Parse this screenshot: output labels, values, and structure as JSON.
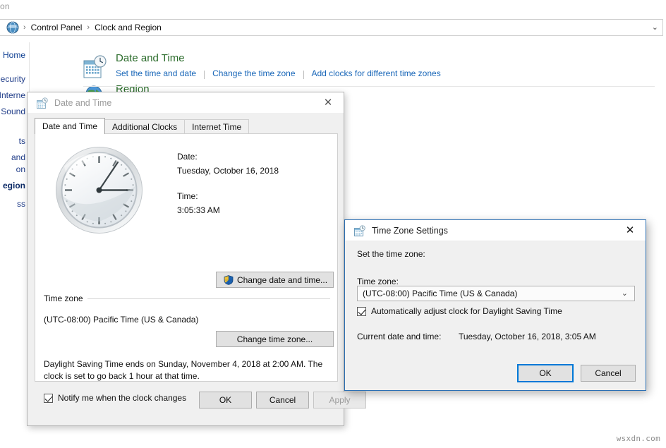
{
  "control_panel": {
    "partial_window_title": "on",
    "address": {
      "icon": "control-panel-globe-icon",
      "crumb_separator": "›",
      "crumbs": [
        "Control Panel",
        "Clock and Region"
      ],
      "dropdown_arrow": "⌄"
    },
    "nav_items": [
      {
        "label": "l Home",
        "bold": false
      },
      {
        "label": "ecurity",
        "bold": false
      },
      {
        "label": "Interne",
        "bold": false
      },
      {
        "label": "d Sound",
        "bold": false
      },
      {
        "label": "ts",
        "bold": false
      },
      {
        "label": "and",
        "bold": false
      },
      {
        "label": "on",
        "bold": false
      },
      {
        "label": "egion",
        "bold": true
      },
      {
        "label": "ss",
        "bold": false
      }
    ],
    "categories": [
      {
        "icon": "date-and-time-icon",
        "title": "Date and Time",
        "links": [
          "Set the time and date",
          "Change the time zone",
          "Add clocks for different time zones"
        ]
      },
      {
        "icon": "region-globe-icon",
        "title": "Region",
        "links": []
      }
    ]
  },
  "date_time_dialog": {
    "icon": "date-and-time-icon",
    "title": "Date and Time",
    "close_label": "✕",
    "tabs": [
      {
        "label": "Date and Time",
        "selected": true
      },
      {
        "label": "Additional Clocks",
        "selected": false
      },
      {
        "label": "Internet Time",
        "selected": false
      }
    ],
    "clock": {
      "name": "analog-clock",
      "hour": 3,
      "minute": 5,
      "second": 33
    },
    "date_label": "Date:",
    "date_value": "Tuesday, October 16, 2018",
    "time_label": "Time:",
    "time_value": "3:05:33 AM",
    "change_date_time_button": "Change date and time...",
    "timezone_group_label": "Time zone",
    "timezone_value": "(UTC-08:00) Pacific Time (US & Canada)",
    "change_timezone_button": "Change time zone...",
    "dst_note": "Daylight Saving Time ends on Sunday, November 4, 2018 at 2:00 AM. The clock is set to go back 1 hour at that time.",
    "notify_checkbox": {
      "label": "Notify me when the clock changes",
      "checked": true
    },
    "footer": {
      "ok": "OK",
      "cancel": "Cancel",
      "apply": "Apply",
      "apply_disabled": true
    }
  },
  "timezone_dialog": {
    "icon": "date-and-time-icon",
    "title": "Time Zone Settings",
    "close_label": "✕",
    "set_label": "Set the time zone:",
    "zone_label": "Time zone:",
    "zone_selected": "(UTC-08:00) Pacific Time (US & Canada)",
    "zone_dropdown_arrow": "⌄",
    "dst_checkbox": {
      "label": "Automatically adjust clock for Daylight Saving Time",
      "checked": true
    },
    "current_label": "Current date and time:",
    "current_value": "Tuesday, October 16, 2018, 3:05 AM",
    "ok": "OK",
    "cancel": "Cancel"
  },
  "watermark": "wsxdn.com",
  "colors": {
    "link_blue": "#1866b8",
    "category_green": "#2a6b2a",
    "nav_blue": "#1f3c88",
    "focus_blue": "#0078d7",
    "active_dialog_border": "#2b6fb3",
    "dialog_face": "#f0f0f0"
  }
}
